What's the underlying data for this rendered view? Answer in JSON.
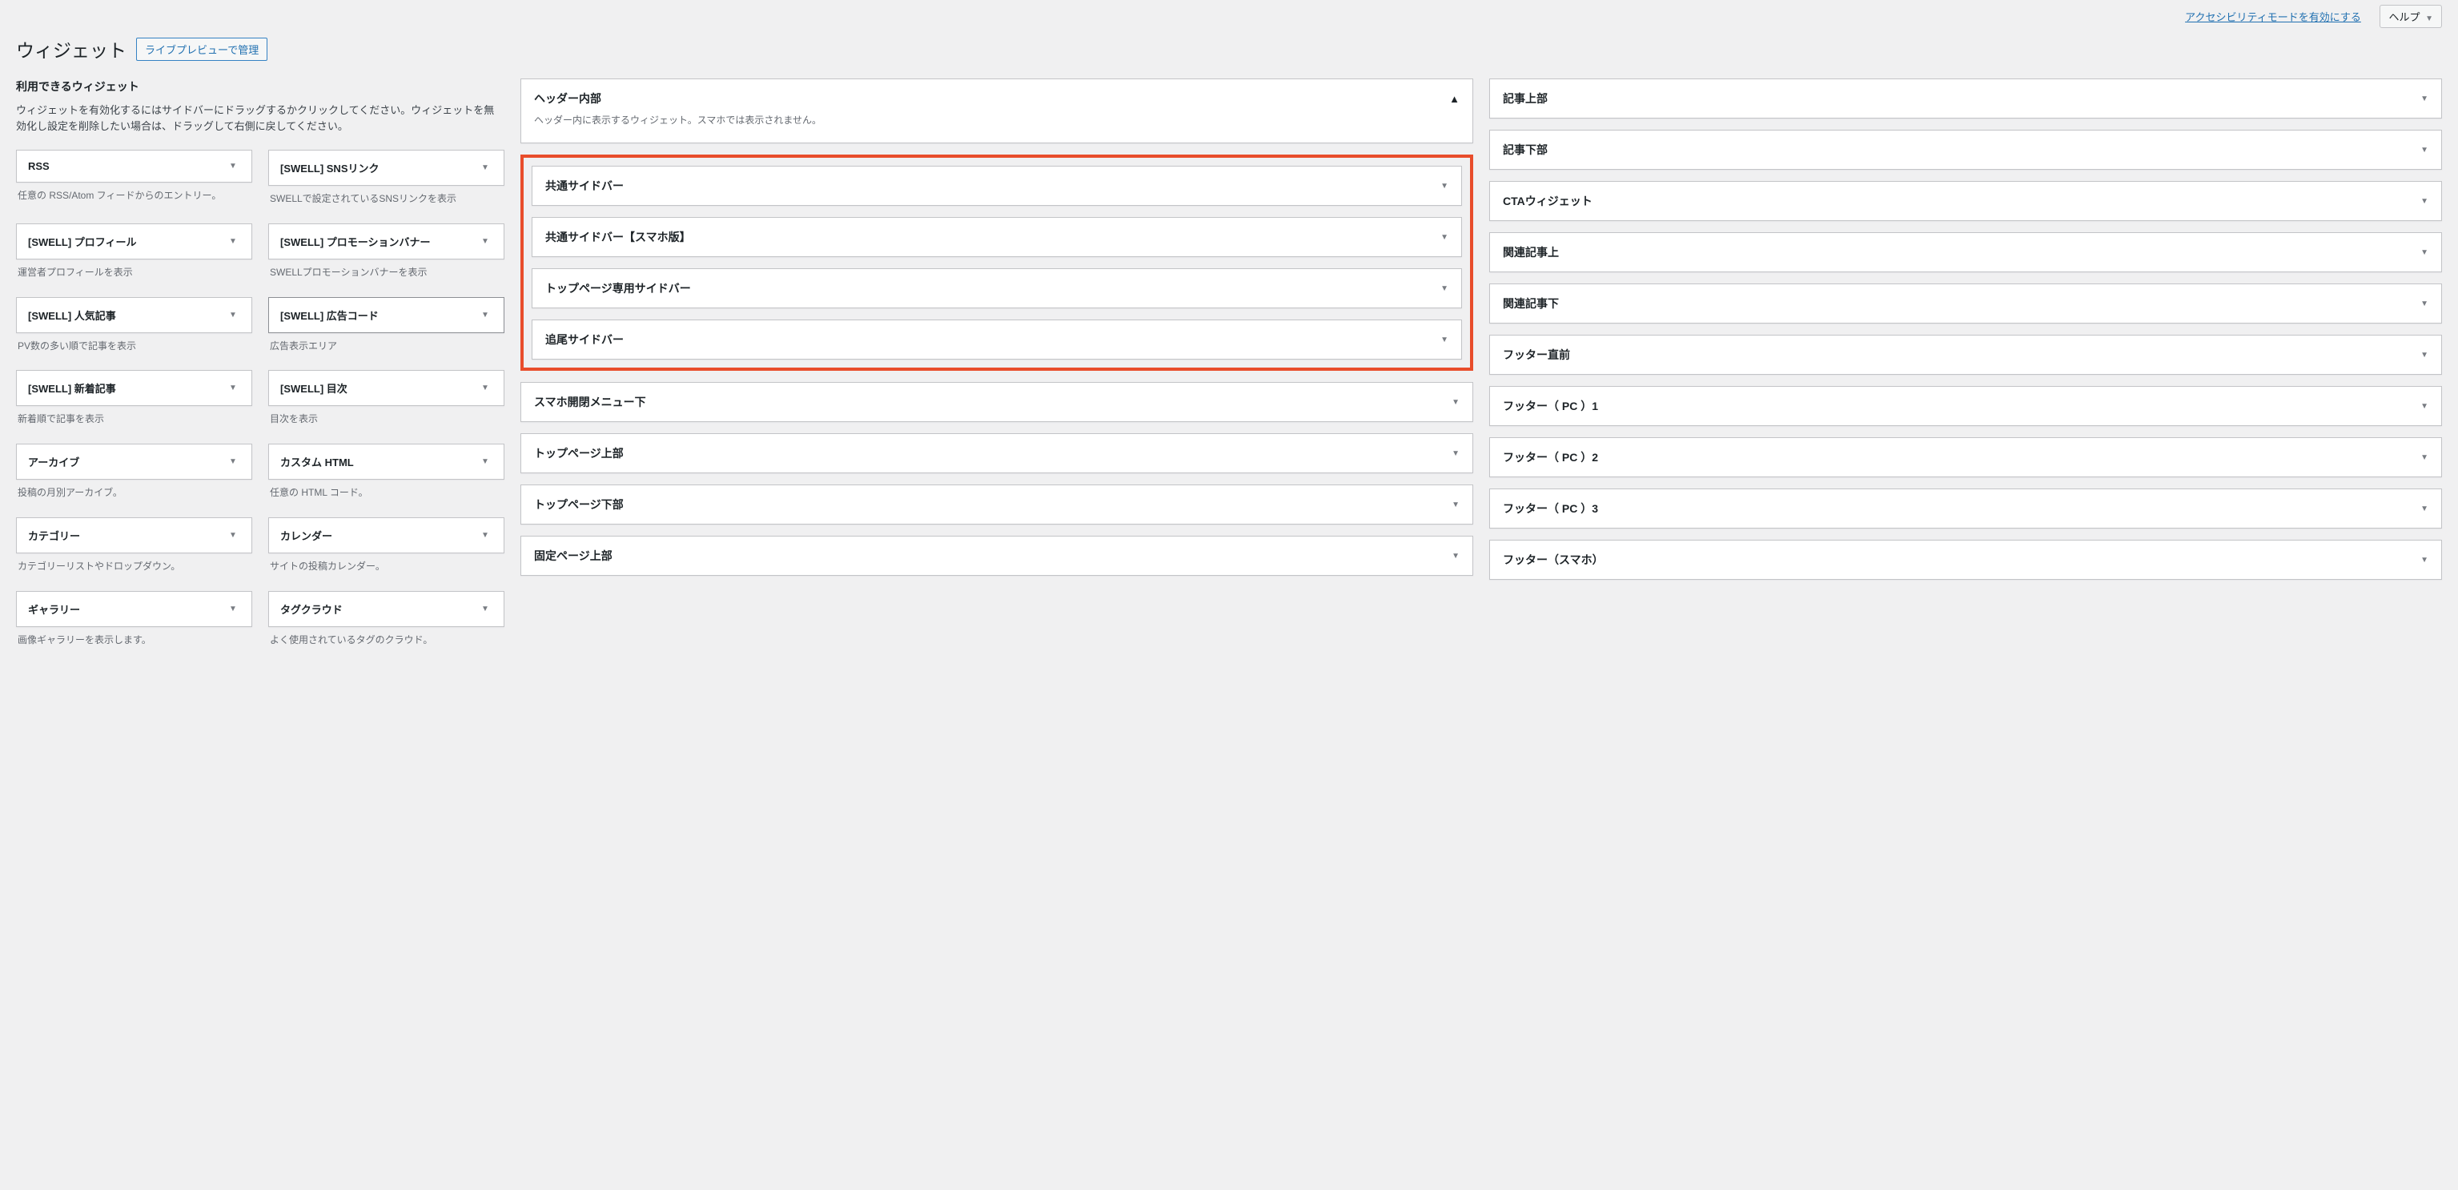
{
  "top": {
    "accessibility_link": "アクセシビリティモードを有効にする",
    "help_label": "ヘルプ"
  },
  "header": {
    "title": "ウィジェット",
    "preview_button": "ライブプレビューで管理"
  },
  "available": {
    "title": "利用できるウィジェット",
    "description": "ウィジェットを有効化するにはサイドバーにドラッグするかクリックしてください。ウィジェットを無効化し設定を削除したい場合は、ドラッグして右側に戻してください。"
  },
  "widgets": [
    {
      "name": "RSS",
      "desc": "任意の RSS/Atom フィードからのエントリー。"
    },
    {
      "name": "[SWELL] SNSリンク",
      "desc": "SWELLで設定されているSNSリンクを表示"
    },
    {
      "name": "[SWELL] プロフィール",
      "desc": "運営者プロフィールを表示"
    },
    {
      "name": "[SWELL] プロモーションバナー",
      "desc": "SWELLプロモーションバナーを表示"
    },
    {
      "name": "[SWELL] 人気記事",
      "desc": "PV数の多い順で記事を表示"
    },
    {
      "name": "[SWELL] 広告コード",
      "desc": "広告表示エリア",
      "highlight": true
    },
    {
      "name": "[SWELL] 新着記事",
      "desc": "新着順で記事を表示"
    },
    {
      "name": "[SWELL] 目次",
      "desc": "目次を表示"
    },
    {
      "name": "アーカイブ",
      "desc": "投稿の月別アーカイブ。"
    },
    {
      "name": "カスタム HTML",
      "desc": "任意の HTML コード。"
    },
    {
      "name": "カテゴリー",
      "desc": "カテゴリーリストやドロップダウン。"
    },
    {
      "name": "カレンダー",
      "desc": "サイトの投稿カレンダー。"
    },
    {
      "name": "ギャラリー",
      "desc": "画像ギャラリーを表示します。"
    },
    {
      "name": "タグクラウド",
      "desc": "よく使用されているタグのクラウド。"
    }
  ],
  "mid_areas": {
    "first": {
      "title": "ヘッダー内部",
      "desc": "ヘッダー内に表示するウィジェット。スマホでは表示されません。"
    },
    "highlighted": [
      "共通サイドバー",
      "共通サイドバー【スマホ版】",
      "トップページ専用サイドバー",
      "追尾サイドバー"
    ],
    "rest": [
      "スマホ開閉メニュー下",
      "トップページ上部",
      "トップページ下部",
      "固定ページ上部"
    ]
  },
  "right_areas": [
    "記事上部",
    "記事下部",
    "CTAウィジェット",
    "関連記事上",
    "関連記事下",
    "フッター直前",
    "フッター（ PC ）1",
    "フッター（ PC ）2",
    "フッター（ PC ）3",
    "フッター（スマホ）"
  ]
}
